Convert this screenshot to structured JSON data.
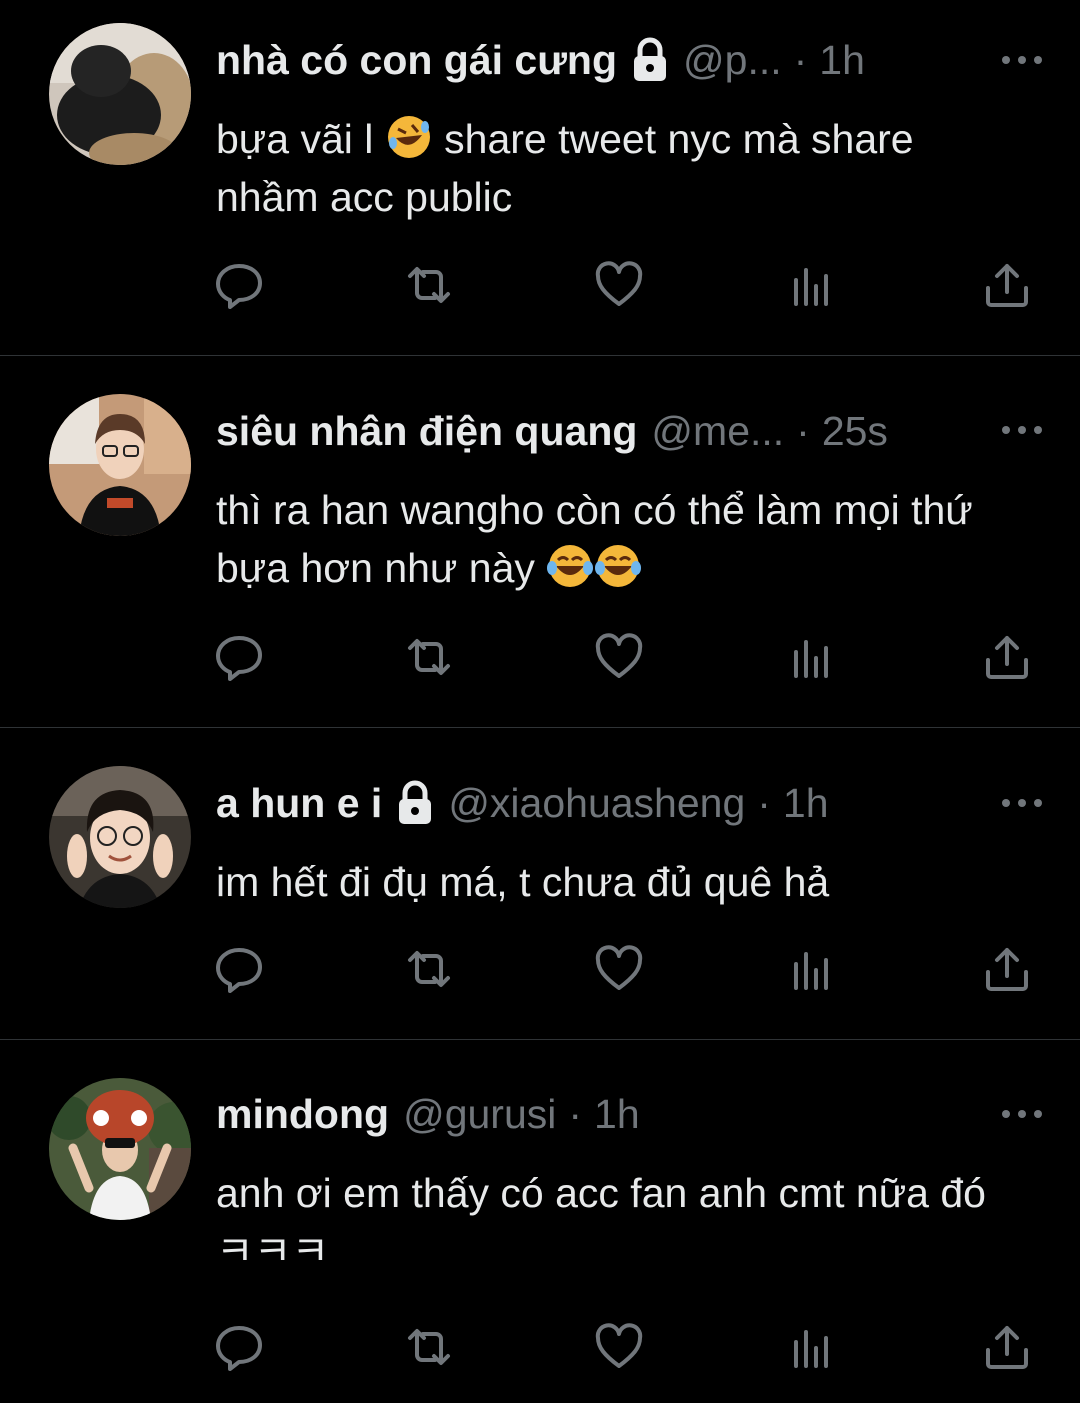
{
  "tweets": [
    {
      "name": "nhà có con gái cưng",
      "protected": true,
      "handle": "@p...",
      "separator": "·",
      "time": "1h",
      "text_before": "bựa vãi l ",
      "emoji": "rolling-on-floor-laughing",
      "text_after": " share tweet nyc mà share nhầm acc public"
    },
    {
      "name": "siêu nhân điện quang",
      "protected": false,
      "handle": "@me...",
      "separator": "·",
      "time": "25s",
      "text_before": "thì ra han wangho còn có thể làm mọi thứ bựa hơn như này ",
      "emoji": "tears-of-joy x2",
      "text_after": ""
    },
    {
      "name": "a hun e i",
      "protected": true,
      "handle": "@xiaohuasheng",
      "separator": "·",
      "time": "1h",
      "text_before": "im hết đi đụ má, t chưa đủ quê hả",
      "emoji": "",
      "text_after": ""
    },
    {
      "name": "mindong",
      "protected": false,
      "handle": "@gurusi",
      "separator": "·",
      "time": "1h",
      "text_before": "anh ơi em thấy có acc fan anh cmt nữa đó ㅋㅋㅋ",
      "emoji": "",
      "text_after": ""
    }
  ],
  "icons": {
    "reply": "reply-icon",
    "retweet": "retweet-icon",
    "like": "heart-icon",
    "views": "views-icon",
    "share": "share-icon",
    "more": "more-icon",
    "lock": "lock-icon"
  },
  "colors": {
    "background": "#000000",
    "text": "#e7e9ea",
    "secondary": "#71767b",
    "divider": "#2f3336"
  }
}
